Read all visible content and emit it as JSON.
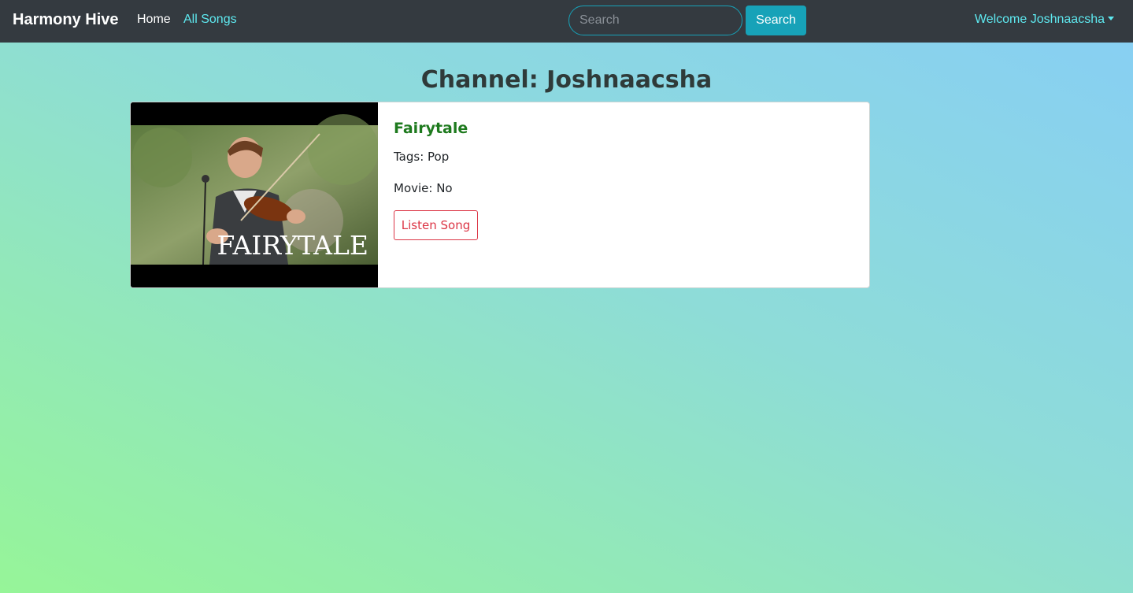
{
  "navbar": {
    "brand": "Harmony Hive",
    "links": [
      {
        "label": "Home"
      },
      {
        "label": "All Songs"
      }
    ],
    "search": {
      "placeholder": "Search",
      "value": "",
      "button_label": "Search"
    },
    "user_menu": {
      "label": "Welcome Joshnaacsha"
    }
  },
  "page": {
    "title": "Channel: Joshnaacsha"
  },
  "songs": [
    {
      "title": "Fairytale",
      "thumbnail_caption": "FAIRYTALE",
      "tags_label": "Tags: Pop",
      "movie_label": "Movie: No",
      "action_label": "Listen Song"
    }
  ],
  "colors": {
    "navbar_bg": "#343a40",
    "accent_cyan": "#17a2b8",
    "link_cyan": "#5ee9f0",
    "song_title_green": "#1e7a1e",
    "listen_red": "#dc3545",
    "bg_gradient_top_right": "#87cef5",
    "bg_gradient_bottom_left": "#96f598"
  },
  "icons": {
    "user_menu": "caret-down-icon"
  }
}
